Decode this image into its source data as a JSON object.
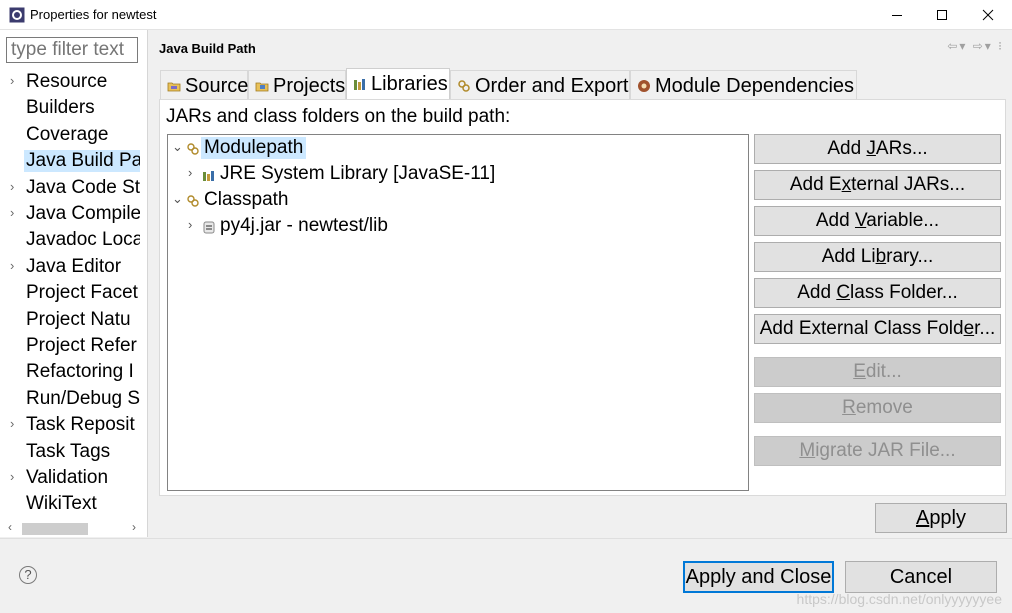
{
  "window": {
    "title": "Properties for newtest",
    "controls": [
      "minimize-icon",
      "maximize-icon",
      "close-icon"
    ]
  },
  "filter": {
    "placeholder": "type filter text"
  },
  "nav": {
    "items": [
      {
        "label": "Resource",
        "expandable": true
      },
      {
        "label": "Builders",
        "expandable": false
      },
      {
        "label": "Coverage",
        "expandable": false
      },
      {
        "label": "Java Build Pa",
        "expandable": false,
        "selected": true
      },
      {
        "label": "Java Code St",
        "expandable": true
      },
      {
        "label": "Java Compile",
        "expandable": true
      },
      {
        "label": "Javadoc Loca",
        "expandable": false
      },
      {
        "label": "Java Editor",
        "expandable": true
      },
      {
        "label": "Project Facet",
        "expandable": false
      },
      {
        "label": "Project Natu",
        "expandable": false
      },
      {
        "label": "Project Refer",
        "expandable": false
      },
      {
        "label": "Refactoring I",
        "expandable": false
      },
      {
        "label": "Run/Debug S",
        "expandable": false
      },
      {
        "label": "Task Reposit",
        "expandable": true
      },
      {
        "label": "Task Tags",
        "expandable": false
      },
      {
        "label": "Validation",
        "expandable": true
      },
      {
        "label": "WikiText",
        "expandable": false
      }
    ]
  },
  "page": {
    "title": "Java Build Path"
  },
  "tabs": [
    {
      "label": "Source"
    },
    {
      "label": "Projects"
    },
    {
      "label": "Libraries",
      "active": true
    },
    {
      "label": "Order and Export"
    },
    {
      "label": "Module Dependencies"
    }
  ],
  "libraries": {
    "heading": "JARs and class folders on the build path:",
    "tree": [
      {
        "label": "Modulepath",
        "expanded": true,
        "selected": true,
        "children": [
          {
            "label": "JRE System Library [JavaSE-11]"
          }
        ]
      },
      {
        "label": "Classpath",
        "expanded": true,
        "children": [
          {
            "label": "py4j.jar - newtest/lib"
          }
        ]
      }
    ],
    "buttons": [
      {
        "pre": "Add ",
        "u": "J",
        "post": "ARs...",
        "enabled": true
      },
      {
        "pre": "Add E",
        "u": "x",
        "post": "ternal JARs...",
        "enabled": true
      },
      {
        "pre": "Add ",
        "u": "V",
        "post": "ariable...",
        "enabled": true
      },
      {
        "pre": "Add Li",
        "u": "b",
        "post": "rary...",
        "enabled": true
      },
      {
        "pre": "Add ",
        "u": "C",
        "post": "lass Folder...",
        "enabled": true
      },
      {
        "pre": "Add External Class Fold",
        "u": "e",
        "post": "r...",
        "enabled": true
      },
      {
        "pre": "",
        "u": "E",
        "post": "dit...",
        "enabled": false
      },
      {
        "pre": "",
        "u": "R",
        "post": "emove",
        "enabled": false
      },
      {
        "pre": "",
        "u": "M",
        "post": "igrate JAR File...",
        "enabled": false
      }
    ]
  },
  "apply": {
    "pre": "",
    "u": "A",
    "post": "pply"
  },
  "footer": {
    "help": "?",
    "apply_close": "Apply and Close",
    "cancel": "Cancel",
    "watermark": "https://blog.csdn.net/onlyyyyyyee"
  },
  "colors": {
    "selection": "#cce8ff",
    "default_button_border": "#0078d7"
  }
}
